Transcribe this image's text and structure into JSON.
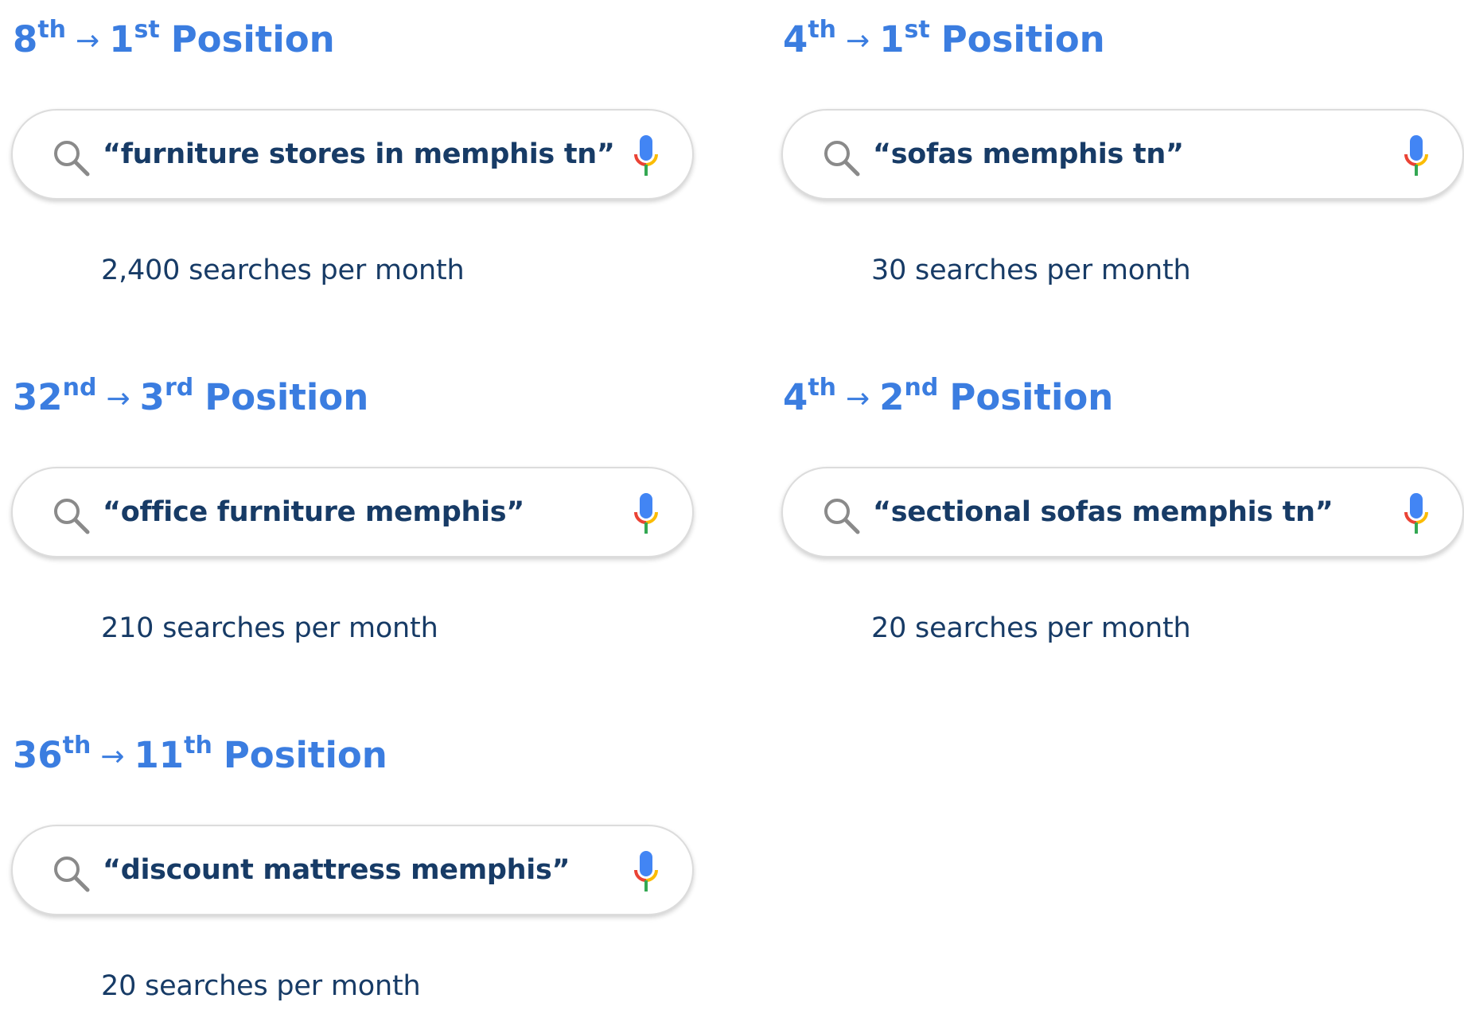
{
  "colors": {
    "title": "#3b7de0",
    "text": "#173b66",
    "search_border": "#dcdcdc",
    "mic_blue": "#4285f4",
    "mic_red": "#ea4335",
    "mic_yellow": "#fbbc05",
    "mic_green": "#34a853"
  },
  "icons": {
    "search": "search-icon",
    "mic": "mic-icon"
  },
  "cards": [
    {
      "from_number": "8",
      "from_suffix": "th",
      "arrow": "→",
      "to_number": "1",
      "to_suffix": "st",
      "position_word": "Position",
      "query": "“furniture stores in memphis tn”",
      "volume": "2,400 searches per month"
    },
    {
      "from_number": "4",
      "from_suffix": "th",
      "arrow": "→",
      "to_number": "1",
      "to_suffix": "st",
      "position_word": "Position",
      "query": "“sofas memphis tn”",
      "volume": "30 searches per month"
    },
    {
      "from_number": "32",
      "from_suffix": "nd",
      "arrow": "→",
      "to_number": "3",
      "to_suffix": "rd",
      "position_word": "Position",
      "query": "“office furniture memphis”",
      "volume": "210 searches per month"
    },
    {
      "from_number": "4",
      "from_suffix": "th",
      "arrow": "→",
      "to_number": "2",
      "to_suffix": "nd",
      "position_word": "Position",
      "query": "“sectional sofas memphis tn”",
      "volume": "20 searches per month"
    },
    {
      "from_number": "36",
      "from_suffix": "th",
      "arrow": "→",
      "to_number": "11",
      "to_suffix": "th",
      "position_word": "Position",
      "query": "“discount mattress memphis”",
      "volume": "20 searches per month"
    }
  ]
}
